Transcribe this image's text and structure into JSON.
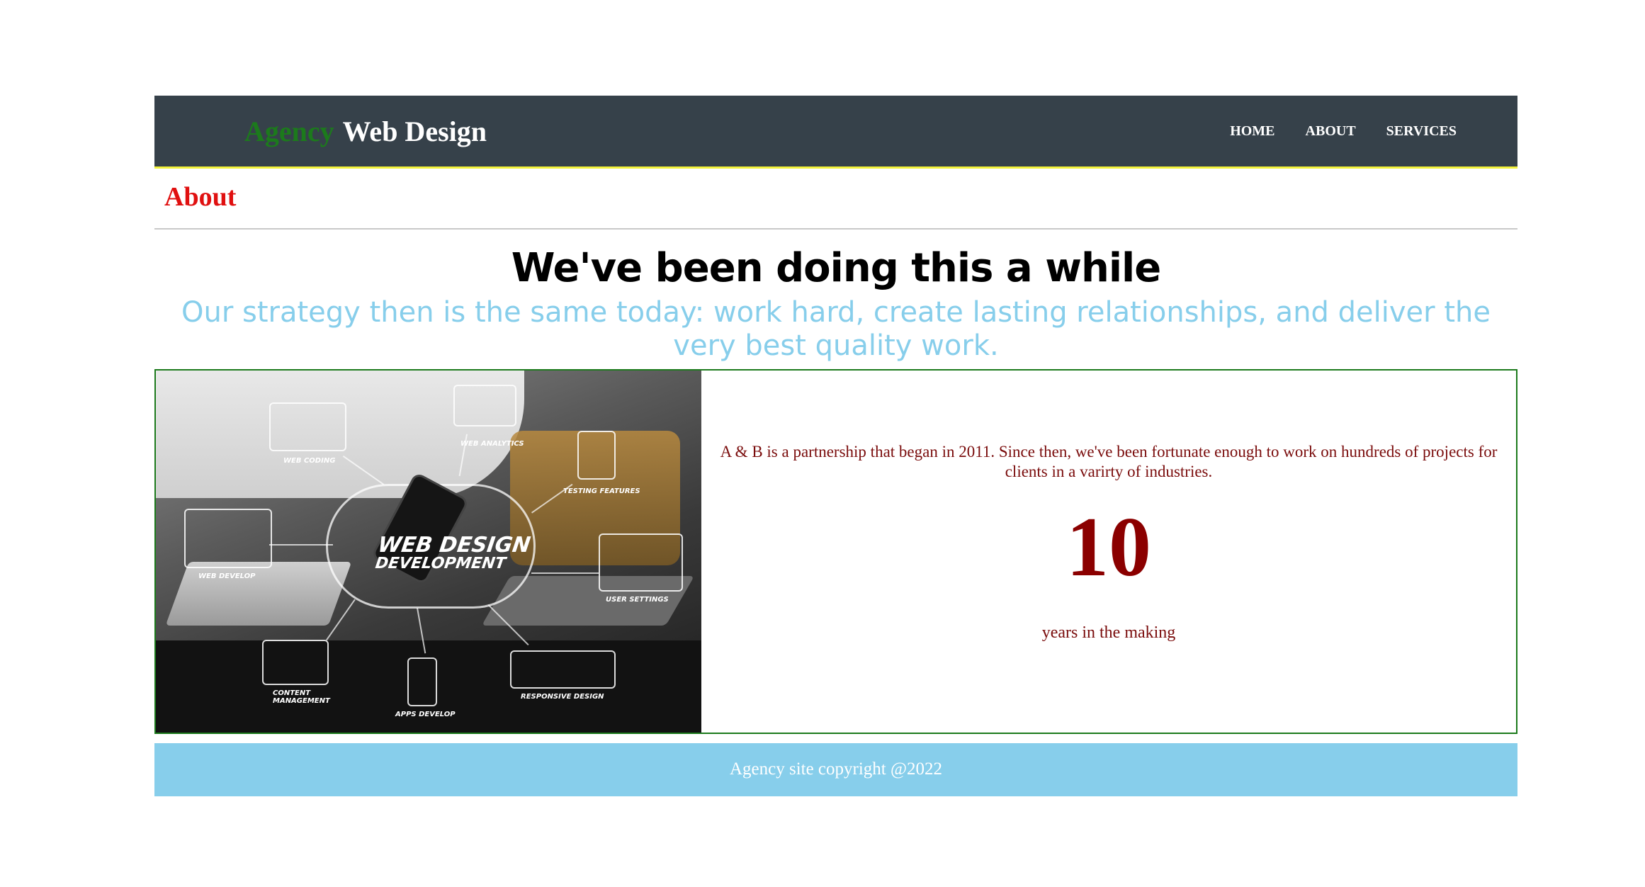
{
  "header": {
    "brand_part1": "Agency",
    "brand_part2": "Web Design",
    "nav": [
      {
        "label": "HOME"
      },
      {
        "label": "ABOUT"
      },
      {
        "label": "SERVICES"
      }
    ]
  },
  "section": {
    "title": "About",
    "headline": "We've been doing this a while",
    "subheadline": "Our strategy then is the same today: work hard, create lasting relationships, and deliver the very best quality work."
  },
  "content": {
    "image": {
      "main_label_line1": "WEB DESIGN",
      "main_label_line2": "DEVELOPMENT",
      "labels": {
        "web_coding": "WEB CODING",
        "web_analytics": "WEB ANALYTICS",
        "testing_features": "TESTING FEATURES",
        "web_develop": "WEB DEVELOP",
        "user_settings": "USER SETTINGS",
        "content_management": "CONTENT MANAGEMENT",
        "apps_develop": "APPS DEVELOP",
        "responsive_design": "RESPONSIVE DESIGN"
      }
    },
    "blurb": "A & B is a partnership that began in 2011. Since then, we've been fortunate enough to work on hundreds of projects for clients in a varirty of industries.",
    "big_number": "10",
    "caption": "years in the making"
  },
  "footer": {
    "text": "Agency site copyright @2022"
  },
  "colors": {
    "header_bg": "#36414a",
    "brand_green": "#1c7a1c",
    "accent_red": "#e01010",
    "subheadline_blue": "#87ceeb",
    "body_text": "#7a0c0c",
    "big_number": "#8b0000",
    "footer_bg": "#87ceeb"
  }
}
